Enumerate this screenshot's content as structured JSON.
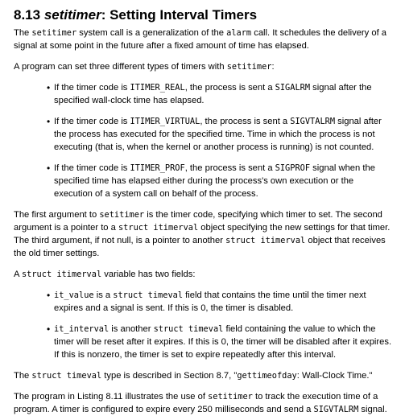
{
  "heading": {
    "number": "8.13",
    "function": "setitimer",
    "rest": ": Setting Interval Timers"
  },
  "intro": {
    "t1": "The ",
    "c1": "setitimer",
    "t2": " system call is a generalization of the ",
    "c2": "alarm",
    "t3": " call. It schedules the delivery of a signal at some point in the future after a fixed amount of time has elapsed."
  },
  "types_intro": {
    "t1": "A program can set three different types of timers with ",
    "c1": "setitimer",
    "t2": ":"
  },
  "timer_types": [
    {
      "t1": "If the timer code is ",
      "c1": "ITIMER_REAL",
      "t2": ", the process is sent a ",
      "c2": "SIGALRM",
      "t3": " signal after the specified wall-clock time has elapsed."
    },
    {
      "t1": "If the timer code is ",
      "c1": "ITIMER_VIRTUAL",
      "t2": ", the process is sent a ",
      "c2": "SIGVTALRM",
      "t3": " signal after the process has executed for the specified time. Time in which the process is not executing (that is, when the kernel or another process is running) is not counted."
    },
    {
      "t1": "If the timer code is ",
      "c1": "ITIMER_PROF",
      "t2": ", the process is sent a ",
      "c2": "SIGPROF",
      "t3": " signal when the specified time has elapsed either during the process's own execution or the execution of a system call on behalf of the process."
    }
  ],
  "arguments": {
    "t1": "The first argument to ",
    "c1": "setitimer",
    "t2": " is the timer code, specifying which timer to set. The second argument is a pointer to a ",
    "c2": "struct itimerval",
    "t3": " object specifying the new settings for that timer. The third argument, if not null, is a pointer to another ",
    "c3": "struct itimerval",
    "t4": " object that receives the old timer settings."
  },
  "fields_intro": {
    "t1": "A ",
    "c1": "struct itimerval",
    "t2": " variable has two fields:"
  },
  "fields": [
    {
      "c1": "it_value",
      "t1": " is a ",
      "c2": "struct timeval",
      "t2": " field that contains the time until the timer next expires and a signal is sent. If this is 0, the timer is disabled."
    },
    {
      "c1": "it_interval",
      "t1": " is another ",
      "c2": "struct timeval",
      "t2": " field containing the value to which the timer will be reset after it expires. If this is 0, the timer will be disabled after it expires. If this is nonzero, the timer is set to expire repeatedly after this interval."
    }
  ],
  "timeval_note": {
    "t1": "The ",
    "c1": "struct timeval",
    "t2": " type is described in Section 8.7, \"",
    "c2": "gettimeofday",
    "t3": ": Wall-Clock Time.\""
  },
  "listing_note": {
    "t1": "The program in Listing 8.11 illustrates the use of ",
    "c1": "setitimer",
    "t2": " to track the execution time of a program. A timer is configured to expire every 250 milliseconds and send a ",
    "c2": "SIGVTALRM",
    "t3": " signal."
  },
  "bullet_glyph": "•"
}
